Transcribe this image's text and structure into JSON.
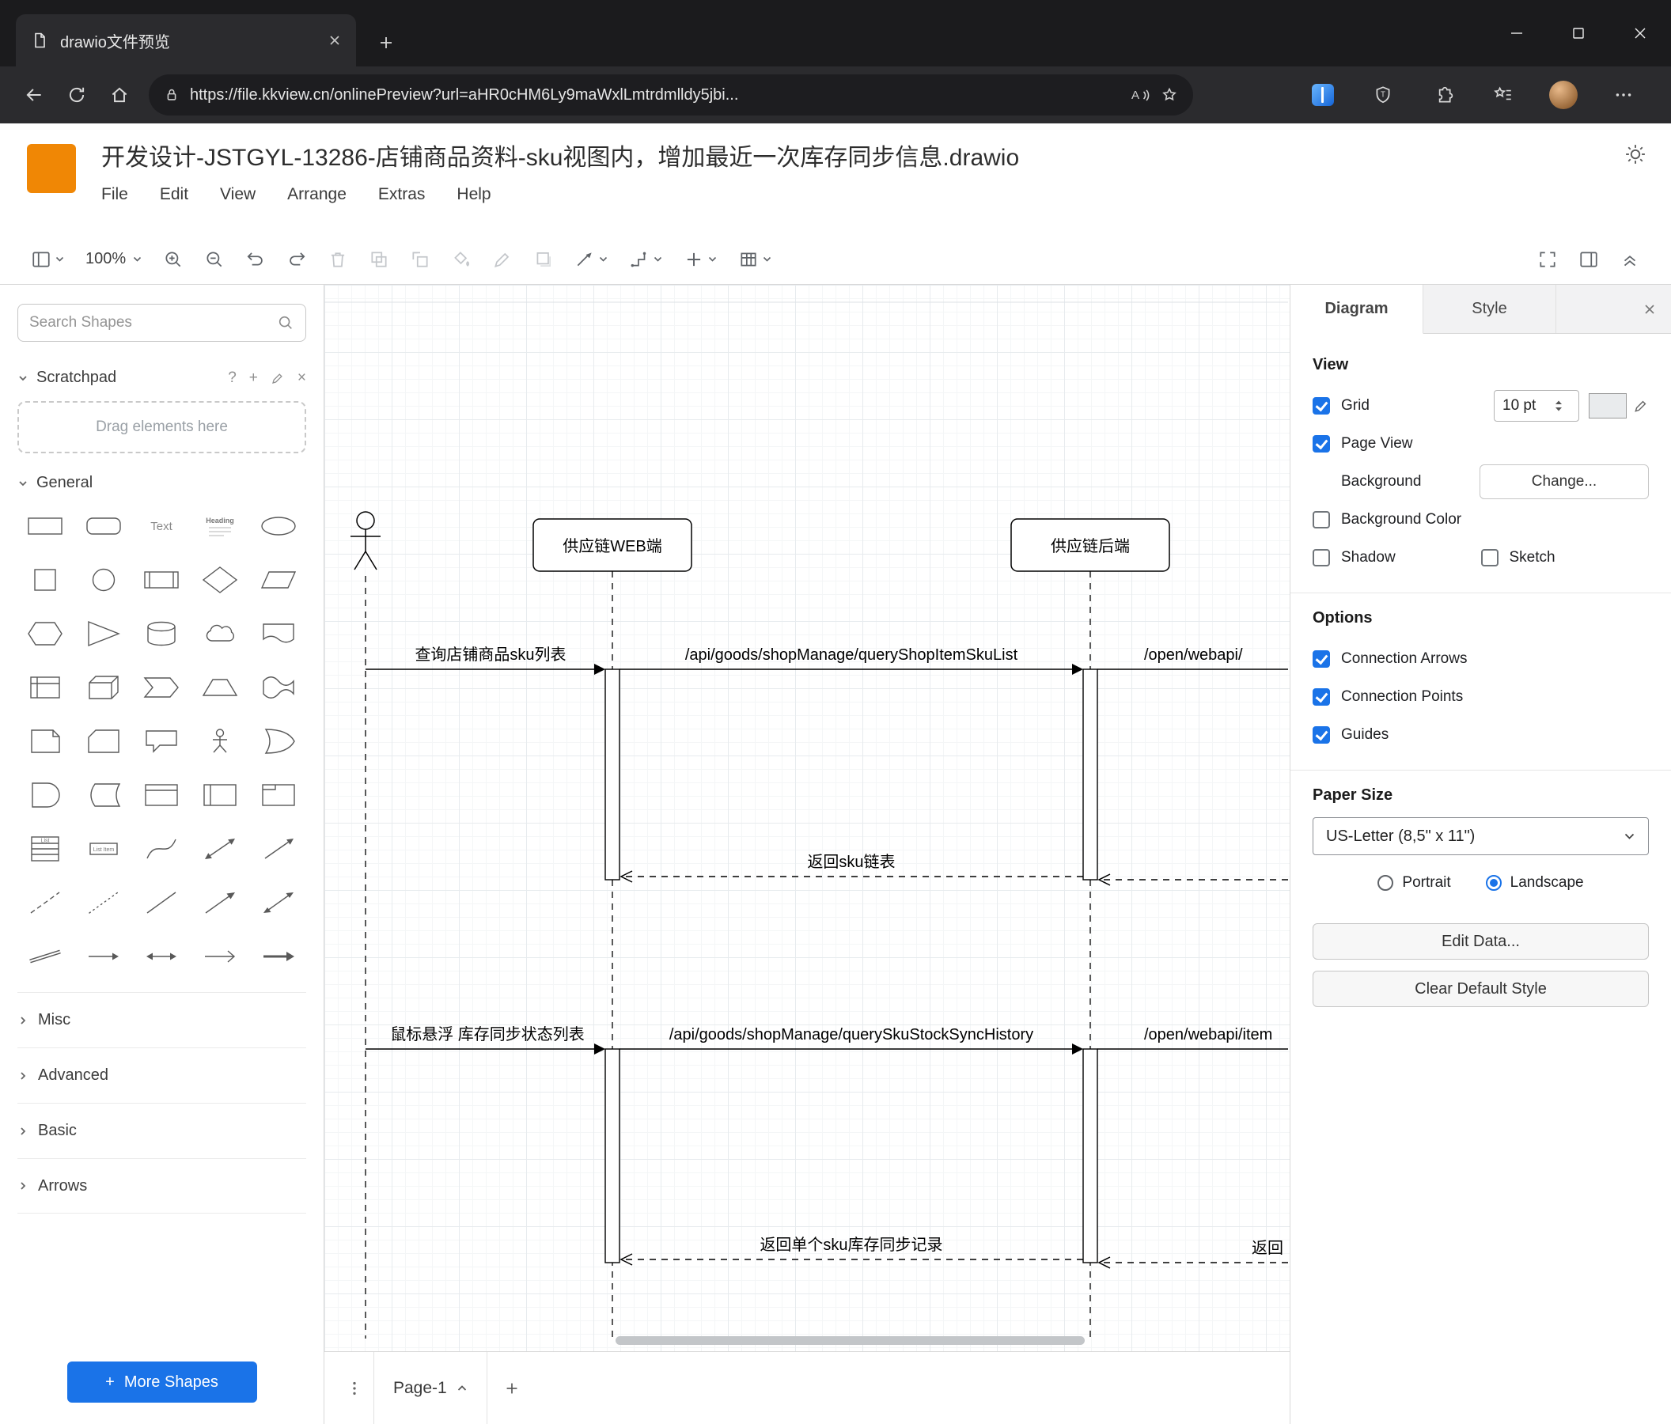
{
  "colors": {
    "accent": "#1a73e8",
    "logo_orange": "#F08705"
  },
  "browser": {
    "tab_title": "drawio文件预览",
    "url": "https://file.kkview.cn/onlinePreview?url=aHR0cHM6Ly9maWxlLmtrdmlldy5jbi...",
    "read_aloud": "A"
  },
  "app": {
    "title": "开发设计-JSTGYL-13286-店铺商品资料-sku视图内，增加最近一次库存同步信息.drawio",
    "menus": [
      "File",
      "Edit",
      "View",
      "Arrange",
      "Extras",
      "Help"
    ],
    "zoom": "100%"
  },
  "sidebar": {
    "search_placeholder": "Search Shapes",
    "scratchpad_label": "Scratchpad",
    "drag_hint": "Drag elements here",
    "section_general": "General",
    "collapsed_sections": [
      "Misc",
      "Advanced",
      "Basic",
      "Arrows"
    ],
    "shape_text_labels": {
      "text": "Text",
      "heading": "Heading",
      "list": "List",
      "list_item": "List Item"
    },
    "shapes": [
      "rectangle",
      "rounded-rectangle",
      "text",
      "heading",
      "ellipse",
      "square",
      "circle",
      "process",
      "diamond",
      "parallelogram",
      "hexagon",
      "triangle",
      "cylinder",
      "cloud",
      "document",
      "internal-storage",
      "cube",
      "step",
      "trapezoid",
      "tape",
      "note",
      "card",
      "callout",
      "actor",
      "or",
      "and",
      "data-storage",
      "container",
      "vertical-container",
      "frame",
      "list",
      "list-item",
      "curve",
      "bidirectional-arrow",
      "arrow",
      "dashed-line",
      "dotted-line",
      "line",
      "directional-connector",
      "bidirectional-connector",
      "link",
      "horizontal-arrow",
      "horizontal-double-arrow",
      "open-arrow",
      "filled-arrow"
    ],
    "more_shapes": "More Shapes"
  },
  "canvas": {
    "participants": [
      "供应链WEB端",
      "供应链后端"
    ],
    "messages": {
      "m1": "查询店铺商品sku列表",
      "m2": "/api/goods/shopManage/queryShopItemSkuList",
      "m3": "/open/webapi/",
      "r1": "返回sku链表",
      "m4": "鼠标悬浮 库存同步状态列表",
      "m5": "/api/goods/shopManage/querySkuStockSyncHistory",
      "m6": "/open/webapi/item",
      "r2": "返回单个sku库存同步记录",
      "r3": "返回"
    }
  },
  "pagebar": {
    "page_label": "Page-1"
  },
  "panel": {
    "tab_diagram": "Diagram",
    "tab_style": "Style",
    "view_heading": "View",
    "grid_label": "Grid",
    "grid_size": "10 pt",
    "page_view_label": "Page View",
    "background_label": "Background",
    "change_button": "Change...",
    "background_color_label": "Background Color",
    "shadow_label": "Shadow",
    "sketch_label": "Sketch",
    "options_heading": "Options",
    "connection_arrows_label": "Connection Arrows",
    "connection_points_label": "Connection Points",
    "guides_label": "Guides",
    "paper_heading": "Paper Size",
    "paper_size_value": "US-Letter (8,5\" x 11\")",
    "portrait_label": "Portrait",
    "landscape_label": "Landscape",
    "edit_data_button": "Edit Data...",
    "clear_style_button": "Clear Default Style"
  }
}
